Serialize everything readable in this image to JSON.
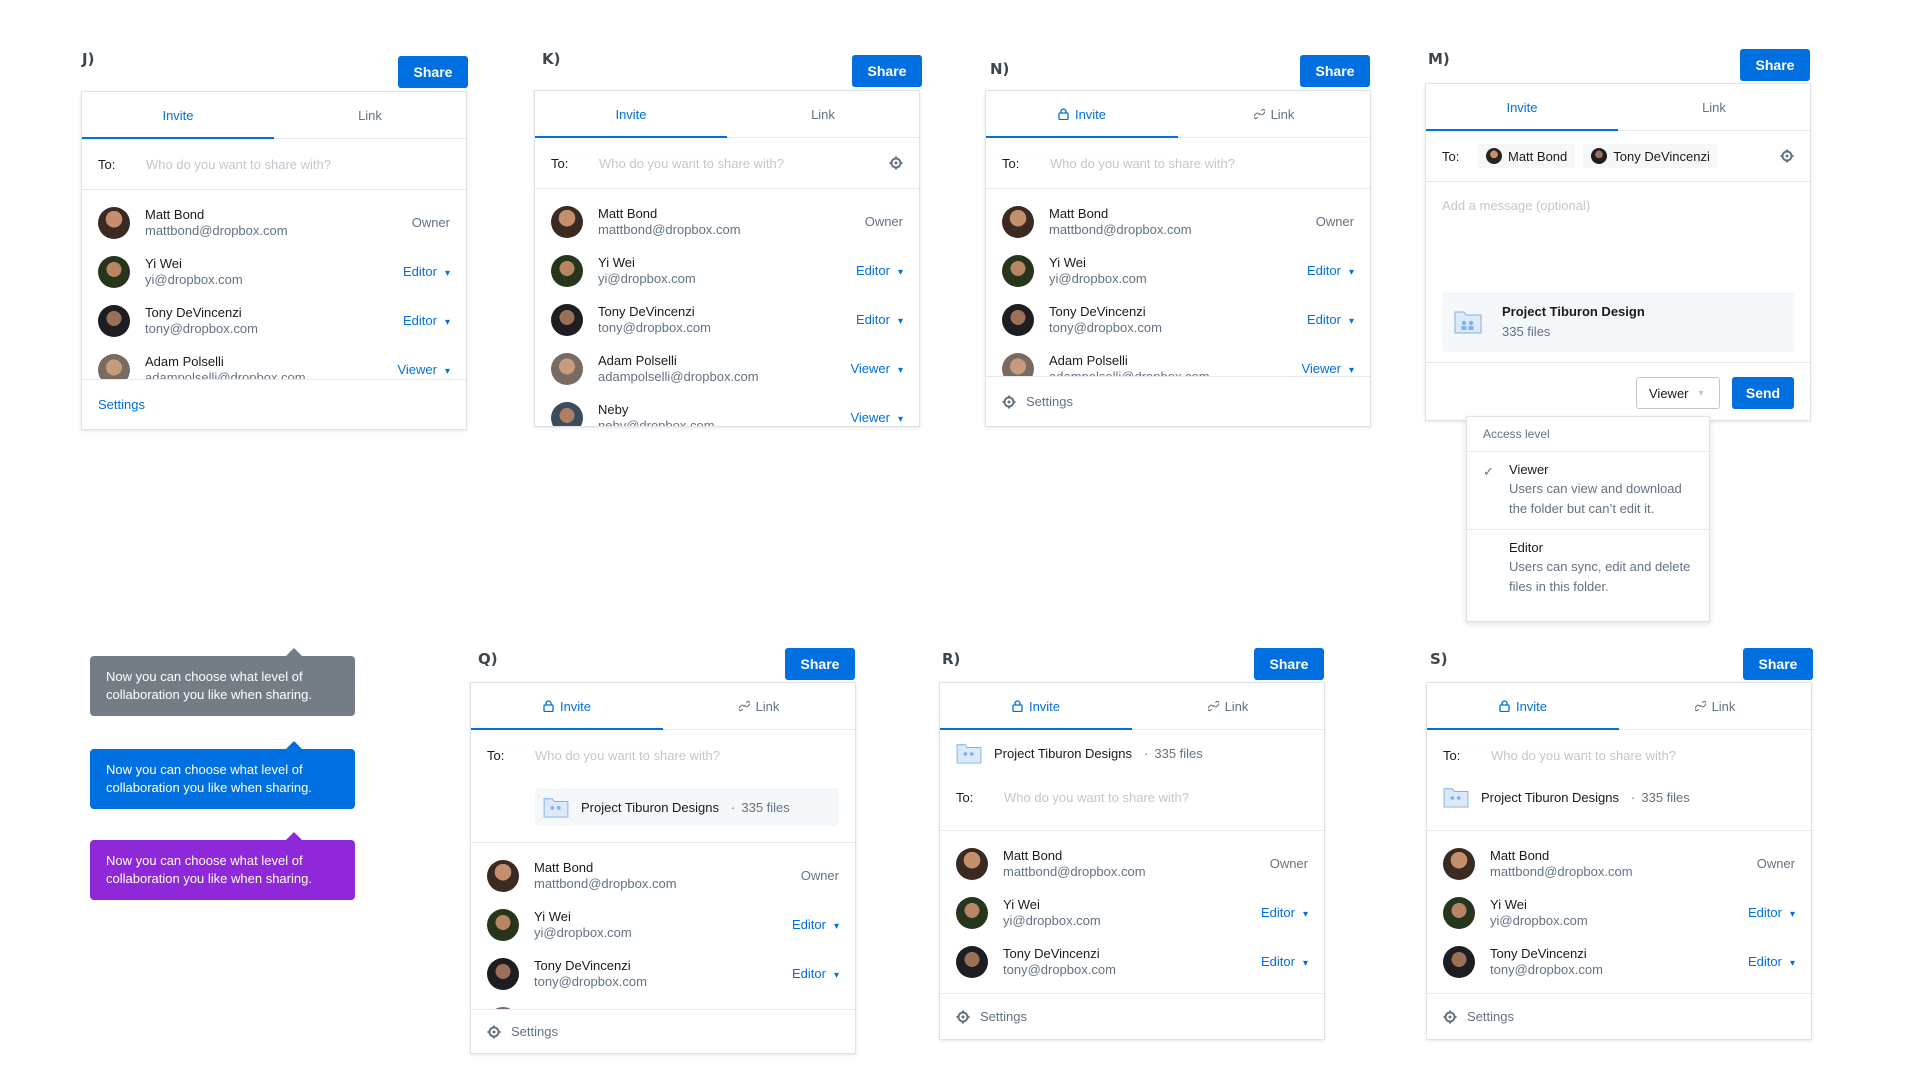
{
  "tabs": {
    "invite": "Invite",
    "link": "Link"
  },
  "share_label": "Share",
  "to_label": "To:",
  "to_placeholder": "Who do you want to share with?",
  "settings_label": "Settings",
  "people": [
    {
      "name": "Matt Bond",
      "email": "mattbond@dropbox.com",
      "role": "Owner"
    },
    {
      "name": "Yi Wei",
      "email": "yi@dropbox.com",
      "role": "Editor"
    },
    {
      "name": "Tony DeVincenzi",
      "email": "tony@dropbox.com",
      "role": "Editor"
    },
    {
      "name": "Adam Polselli",
      "email": "adampolselli@dropbox.com",
      "role": "Viewer"
    },
    {
      "name": "Neby",
      "email": "neby@dropbox.com",
      "role": "Viewer"
    }
  ],
  "variants": {
    "j": "J)",
    "k": "K)",
    "n": "N)",
    "m": "M)",
    "q": "Q)",
    "r": "R)",
    "s": "S)"
  },
  "folder": {
    "name": "Project Tiburon Design",
    "name_plural": "Project Tiburon Designs",
    "files": "335 files",
    "sep": "·"
  },
  "m_panel": {
    "chips": [
      "Matt Bond",
      "Tony DeVincenzi"
    ],
    "message_placeholder": "Add a message (optional)",
    "viewer_select": "Viewer",
    "send": "Send",
    "access_level": "Access level",
    "options": [
      {
        "title": "Viewer",
        "desc": "Users can view and download the folder but can’t edit it."
      },
      {
        "title": "Editor",
        "desc": "Users can sync, edit and delete files in this folder."
      }
    ]
  },
  "tooltips": [
    {
      "text": "Now you can choose what level of collaboration you like when sharing.",
      "color": "#747d85"
    },
    {
      "text": "Now you can choose what level of collaboration you like when sharing.",
      "color": "#0070e0"
    },
    {
      "text": "Now you can choose what level of collaboration you like when sharing.",
      "color": "#8e28d9"
    }
  ]
}
